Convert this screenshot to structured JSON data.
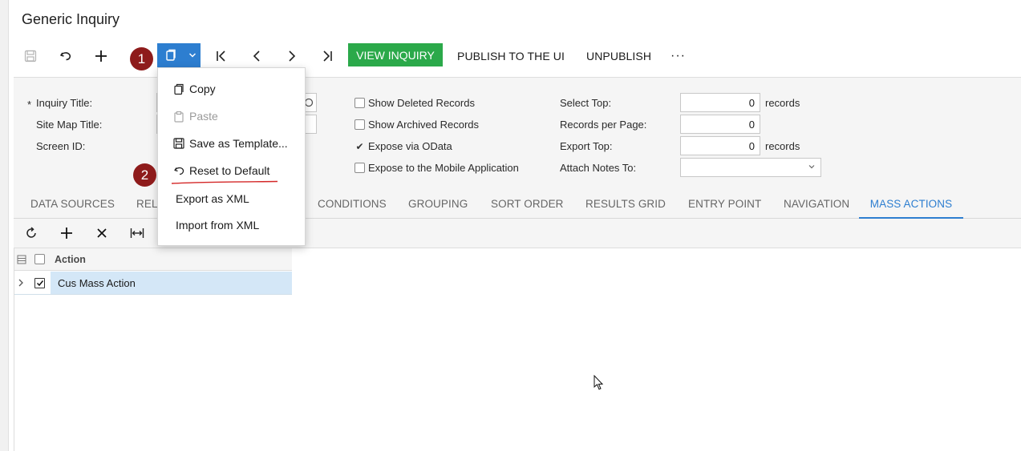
{
  "page": {
    "title": "Generic Inquiry"
  },
  "toolbar": {
    "icons": [
      "save-icon",
      "undo-icon",
      "plus-icon",
      "clipboard-icon",
      "chevron-down-icon",
      "first-record-icon",
      "previous-icon",
      "next-icon",
      "last-record-icon",
      "more-icon"
    ],
    "view_inquiry": "VIEW INQUIRY",
    "publish": "PUBLISH TO THE UI",
    "unpublish": "UNPUBLISH",
    "more": "···"
  },
  "annotations": {
    "badge1": "1",
    "badge2": "2",
    "badge_color": "#8e1b1b"
  },
  "clipboard_menu": {
    "items": [
      {
        "label": "Copy",
        "icon": "copy-icon",
        "enabled": true
      },
      {
        "label": "Paste",
        "icon": "paste-icon",
        "enabled": false
      },
      {
        "label": "Save as Template...",
        "icon": "save-icon",
        "enabled": true
      },
      {
        "label": "Reset to Default",
        "icon": "undo-icon",
        "enabled": true
      },
      {
        "label": "Export as XML",
        "enabled": true
      },
      {
        "label": "Import from XML",
        "enabled": true
      }
    ]
  },
  "form": {
    "required_mark": "*",
    "inquiry_title_label": "Inquiry Title:",
    "site_map_title_label": "Site Map Title:",
    "screen_id_label": "Screen ID:",
    "show_deleted": {
      "label": "Show Deleted Records",
      "checked": false
    },
    "show_archived": {
      "label": "Show Archived Records",
      "checked": false
    },
    "expose_odata": {
      "label": "Expose via OData",
      "checked": true
    },
    "expose_mobile": {
      "label": "Expose to the Mobile Application",
      "checked": false
    },
    "select_top": {
      "label": "Select Top:",
      "value": "0",
      "suffix": "records"
    },
    "records_per_page": {
      "label": "Records per Page:",
      "value": "0"
    },
    "export_top": {
      "label": "Export Top:",
      "value": "0",
      "suffix": "records"
    },
    "attach_notes": {
      "label": "Attach Notes To:",
      "value": ""
    }
  },
  "tabs": [
    {
      "label": "DATA SOURCES",
      "active": false
    },
    {
      "label": "REL",
      "active": false
    },
    {
      "label": "CONDITIONS",
      "active": false
    },
    {
      "label": "GROUPING",
      "active": false
    },
    {
      "label": "SORT ORDER",
      "active": false
    },
    {
      "label": "RESULTS GRID",
      "active": false
    },
    {
      "label": "ENTRY POINT",
      "active": false
    },
    {
      "label": "NAVIGATION",
      "active": false
    },
    {
      "label": "MASS ACTIONS",
      "active": true
    }
  ],
  "grid": {
    "toolbar_icons": [
      "refresh-icon",
      "add-row-icon",
      "delete-row-icon",
      "fit-columns-icon"
    ],
    "columns": [
      "Action"
    ],
    "rows": [
      {
        "action": "Cus Mass Action",
        "selected": true
      }
    ]
  },
  "colors": {
    "accent": "#2d7ed0",
    "view_inquiry_bg": "#2ba94a",
    "selected_row": "#d4e7f7"
  }
}
